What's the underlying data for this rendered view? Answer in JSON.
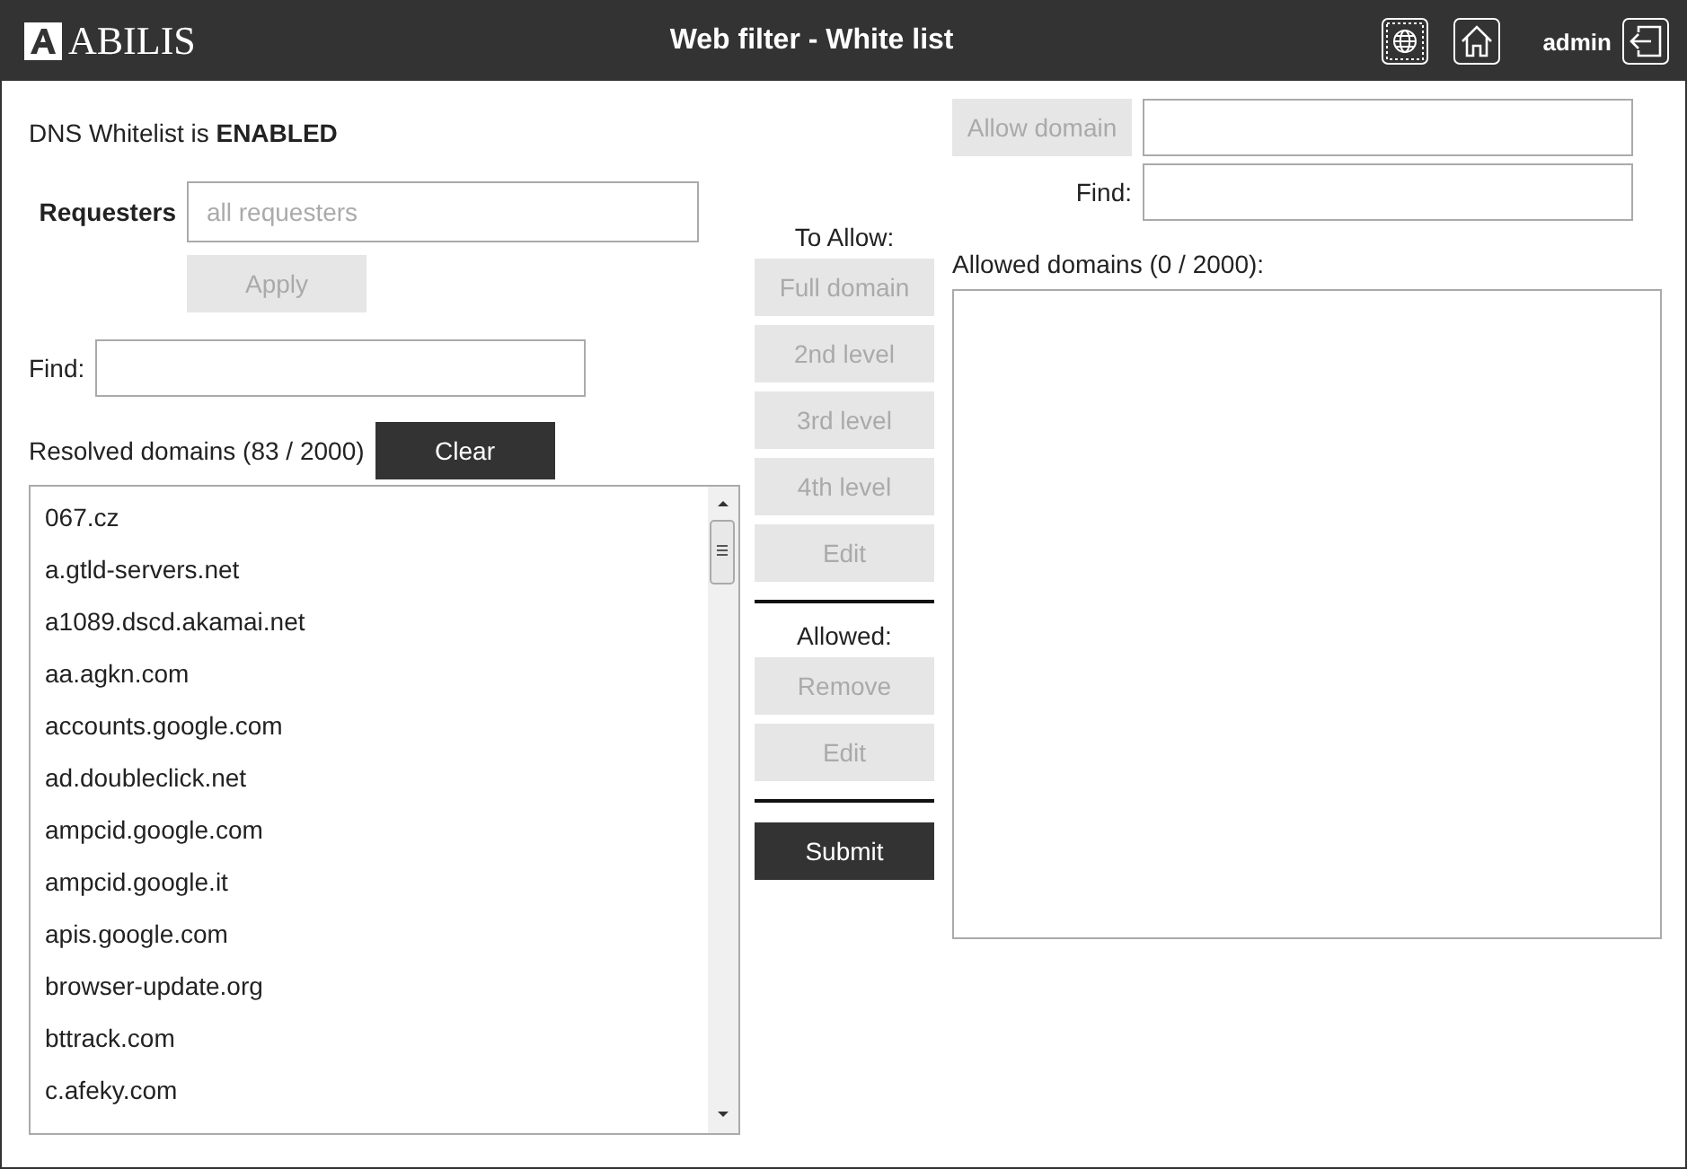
{
  "header": {
    "logo": "ABILIS",
    "title": "Web filter - White list",
    "user": "admin"
  },
  "status": {
    "text": "DNS Whitelist is **ENABLED**"
  },
  "requesters": {
    "label": "Requesters",
    "placeholder": "all requesters",
    "apply": {
      "label": "Apply",
      "disabled": true
    }
  },
  "find": {
    "label": "Find:"
  },
  "resolved": {
    "label": "Resolved domains (83 / 2000)",
    "clear": {
      "label": "Clear",
      "disabled": false
    },
    "items": [
      "067.cz",
      "a.gtld-servers.net",
      "a1089.dscd.akamai.net",
      "aa.agkn.com",
      "accounts.google.com",
      "ad.doubleclick.net",
      "ampcid.google.com",
      "ampcid.google.it",
      "apis.google.com",
      "browser-update.org",
      "bttrack.com",
      "c.afeky.com"
    ]
  },
  "actions": [
    {
      "kind": "heading",
      "label": "To Allow:"
    },
    {
      "kind": "button",
      "label": "Full domain",
      "disabled": true
    },
    {
      "kind": "button",
      "label": "2nd level",
      "disabled": true
    },
    {
      "kind": "button",
      "label": "3rd level",
      "disabled": true
    },
    {
      "kind": "button",
      "label": "4th level",
      "disabled": true
    },
    {
      "kind": "button",
      "label": "Edit",
      "disabled": true
    },
    {
      "kind": "divider"
    },
    {
      "kind": "heading",
      "label": "Allowed:"
    },
    {
      "kind": "button",
      "label": "Remove",
      "disabled": true
    },
    {
      "kind": "button",
      "label": "Edit",
      "disabled": true
    },
    {
      "kind": "divider"
    },
    {
      "kind": "button",
      "label": "Submit",
      "disabled": false
    }
  ],
  "allow": {
    "button": {
      "label": "Allow domain",
      "disabled": true
    },
    "find_label": "Find:",
    "list_label": "Allowed domains (0 / 2000):"
  }
}
